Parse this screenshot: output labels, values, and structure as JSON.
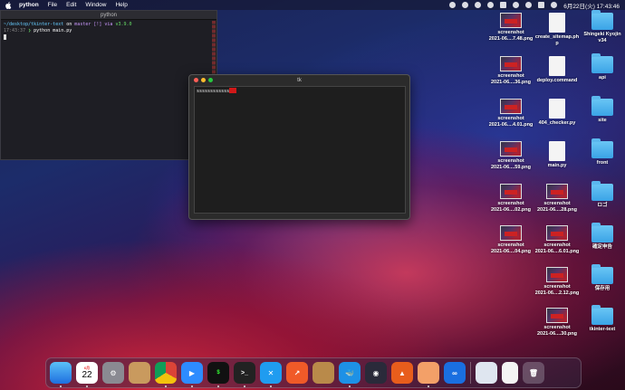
{
  "menubar": {
    "app_name": "python",
    "items": [
      "File",
      "Edit",
      "Window",
      "Help"
    ],
    "clock": "6月22日(火)  17:43:46"
  },
  "terminal": {
    "title": "python",
    "line1_path": "~/desktop/tkinter-text",
    "line1_on": "on",
    "line1_branch": "master",
    "line1_status": "[!] via",
    "line1_version": "v3.9.0",
    "line2_time": "17:43:37",
    "line2_cmd": "python main.py"
  },
  "tk_window": {
    "title": "tk",
    "text_content": "ssssssssssss"
  },
  "desktop_icons": [
    {
      "type": "screenshot",
      "label1": "screenshot",
      "label2": "2021-06....7.48.png"
    },
    {
      "type": "doc",
      "label1": "create_sitemap.ph",
      "label2": "p"
    },
    {
      "type": "folder",
      "label1": "Shingeki Kyojin",
      "label2": "v34"
    },
    {
      "type": "screenshot",
      "label1": "screenshot",
      "label2": "2021-06....36.png"
    },
    {
      "type": "doc",
      "label1": "deploy.command",
      "label2": ""
    },
    {
      "type": "folder",
      "label1": "api",
      "label2": ""
    },
    {
      "type": "screenshot",
      "label1": "screenshot",
      "label2": "2021-06....4.01.png"
    },
    {
      "type": "doc",
      "label1": "404_checker.py",
      "label2": ""
    },
    {
      "type": "folder",
      "label1": "site",
      "label2": ""
    },
    {
      "type": "screenshot",
      "label1": "screenshot",
      "label2": "2021-06....59.png"
    },
    {
      "type": "doc",
      "label1": "main.py",
      "label2": ""
    },
    {
      "type": "folder",
      "label1": "front",
      "label2": ""
    },
    {
      "type": "screenshot",
      "label1": "screenshot",
      "label2": "2021-06....02.png"
    },
    {
      "type": "screenshot",
      "label1": "screenshot",
      "label2": "2021-06....28.png"
    },
    {
      "type": "folder",
      "label1": "ロゴ",
      "label2": ""
    },
    {
      "type": "screenshot",
      "label1": "screenshot",
      "label2": "2021-06....04.png"
    },
    {
      "type": "screenshot",
      "label1": "screenshot",
      "label2": "2021-06....6.01.png"
    },
    {
      "type": "folder",
      "label1": "確定申告",
      "label2": ""
    },
    {
      "type": "screenshot",
      "label1": "screenshot",
      "label2": "2021-06....2.12.png"
    },
    {
      "type": "folder",
      "label1": "保存用",
      "label2": ""
    },
    {
      "type": "screenshot",
      "label1": "screenshot",
      "label2": "2021-06....30.png"
    },
    {
      "type": "folder",
      "label1": "tkinter-text",
      "label2": ""
    }
  ],
  "dock": {
    "calendar_month": "6月",
    "calendar_day": "22",
    "apps": [
      "finder-icon",
      "calendar-icon",
      "system-preferences-icon",
      "contacts-icon",
      "chrome-icon",
      "zoom-icon",
      "terminal-icon",
      "iterm-icon",
      "vscode-icon",
      "tableplus-icon",
      "archive-icon",
      "docker-icon",
      "quicktime-icon",
      "sourcetree-icon",
      "preview-icon",
      "infinity-icon",
      "python-launcher-icon",
      "document-icon",
      "trash-icon"
    ]
  }
}
